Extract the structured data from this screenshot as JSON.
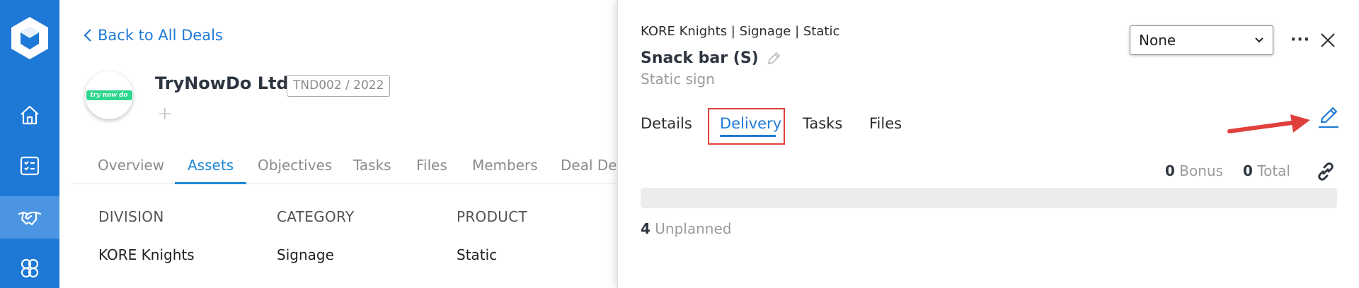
{
  "back_link": {
    "label": "Back to All Deals"
  },
  "company": {
    "name": "TryNowDo Ltd",
    "logo_text": "try now do",
    "deal_code": "TND002 / 2022",
    "add_symbol": "+"
  },
  "main_tabs": [
    {
      "label": "Overview"
    },
    {
      "label": "Assets"
    },
    {
      "label": "Objectives"
    },
    {
      "label": "Tasks"
    },
    {
      "label": "Files"
    },
    {
      "label": "Members"
    },
    {
      "label": "Deal Det"
    }
  ],
  "asset_table": {
    "headers": [
      "DIVISION",
      "CATEGORY",
      "PRODUCT"
    ],
    "row": [
      "KORE Knights",
      "Signage",
      "Static"
    ]
  },
  "drawer": {
    "breadcrumb": "KORE Knights | Signage | Static",
    "title": "Snack bar (S)",
    "subtitle": "Static sign",
    "status_value": "None",
    "more_label": "···",
    "tabs": [
      {
        "label": "Details"
      },
      {
        "label": "Delivery"
      },
      {
        "label": "Tasks"
      },
      {
        "label": "Files"
      }
    ],
    "stats": {
      "bonus_value": "0",
      "bonus_label": "Bonus",
      "total_value": "0",
      "total_label": "Total"
    },
    "progress_fraction": 0,
    "unplanned_value": "4",
    "unplanned_label": "Unplanned"
  },
  "colors": {
    "nav_bg": "#1e78d6",
    "accent": "#1e7ad6",
    "highlight": "#e0403c",
    "logo_green": "#2fd68e"
  },
  "icons": {
    "nav": [
      "home-icon",
      "checklist-icon",
      "handshake-icon",
      "team-icon"
    ],
    "drawer": [
      "edit-pencil-icon",
      "close-icon",
      "more-icon",
      "link-icon",
      "chevron-down-icon"
    ]
  }
}
